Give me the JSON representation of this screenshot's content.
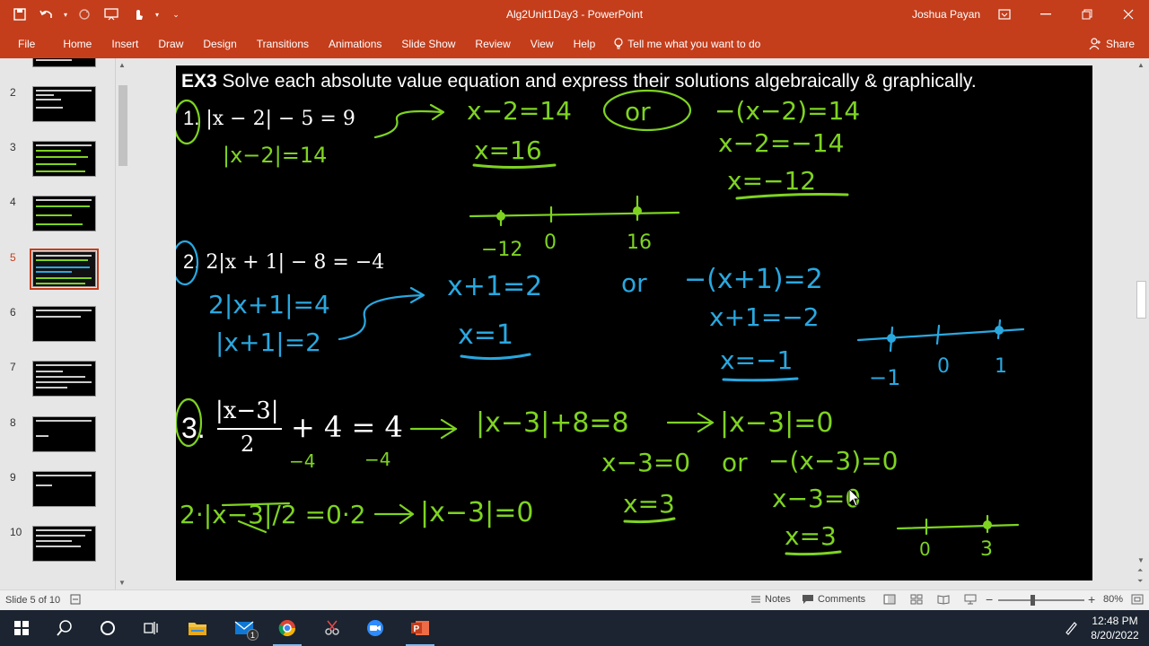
{
  "window": {
    "doc_title": "Alg2Unit1Day3  -  PowerPoint",
    "user_name": "Joshua Payan"
  },
  "ribbon": {
    "tabs": [
      "File",
      "Home",
      "Insert",
      "Draw",
      "Design",
      "Transitions",
      "Animations",
      "Slide Show",
      "Review",
      "View",
      "Help"
    ],
    "tell_me": "Tell me what you want to do",
    "share": "Share"
  },
  "thumbnails": {
    "numbers": [
      "2",
      "3",
      "4",
      "5",
      "6",
      "7",
      "8",
      "9",
      "10"
    ],
    "active": "5"
  },
  "slide": {
    "heading_bold": "EX3",
    "heading_text": " Solve each absolute value equation and express their solutions algebraically & graphically.",
    "problem1": "|x − 2| − 5 = 9",
    "problem2": "2|x + 1| − 8 = −4",
    "problem3_num": "3.",
    "problem3_numerator": "|x−3|",
    "problem3_denominator": "2",
    "problem3_rest": "+ 4 = 4",
    "label1": "1.",
    "label2": "2.",
    "ink": {
      "p1_step": "|x−2|=14",
      "p1_case1": "x−2=14",
      "p1_or": "or",
      "p1_case2": "−(x−2)=14",
      "p1_sol1": "x=16",
      "p1_case2b": "x−2=−14",
      "p1_sol2": "x=−12",
      "p1_ticks": [
        "−12",
        "0",
        "16"
      ],
      "p2_step1": "2|x+1|=4",
      "p2_step2": "|x+1|=2",
      "p2_case1": "x+1=2",
      "p2_or": "or",
      "p2_case2": "−(x+1)=2",
      "p2_sol1": "x=1",
      "p2_case2b": "x+1=−2",
      "p2_sol2": "x=−1",
      "p2_ticks": [
        "−1",
        "0",
        "1"
      ],
      "p3_step1": "|x−3|+8=8",
      "p3_step2": "|x−3|=0",
      "p3_sub": "−4",
      "p3_sub2": "−4",
      "p3_case1": "x−3=0",
      "p3_or": "or",
      "p3_case2": "−(x−3)=0",
      "p3_mult": "2·|x−3|/2 =0·2",
      "p3_mult_res": "|x−3|=0",
      "p3_sol1": "x=3",
      "p3_case2b": "x−3=0",
      "p3_sol2": "x=3",
      "p3_ticks": [
        "0",
        "3"
      ]
    }
  },
  "status": {
    "slide_of": "Slide 5 of 10",
    "notes": "Notes",
    "comments": "Comments",
    "zoom": "80%"
  },
  "taskbar": {
    "time": "12:48 PM",
    "date": "8/20/2022",
    "mail_badge": "1"
  },
  "colors": {
    "accent": "#c43e1c",
    "ink_green": "#7ed321",
    "ink_blue": "#29a8e0",
    "slide_bg": "#000000"
  }
}
